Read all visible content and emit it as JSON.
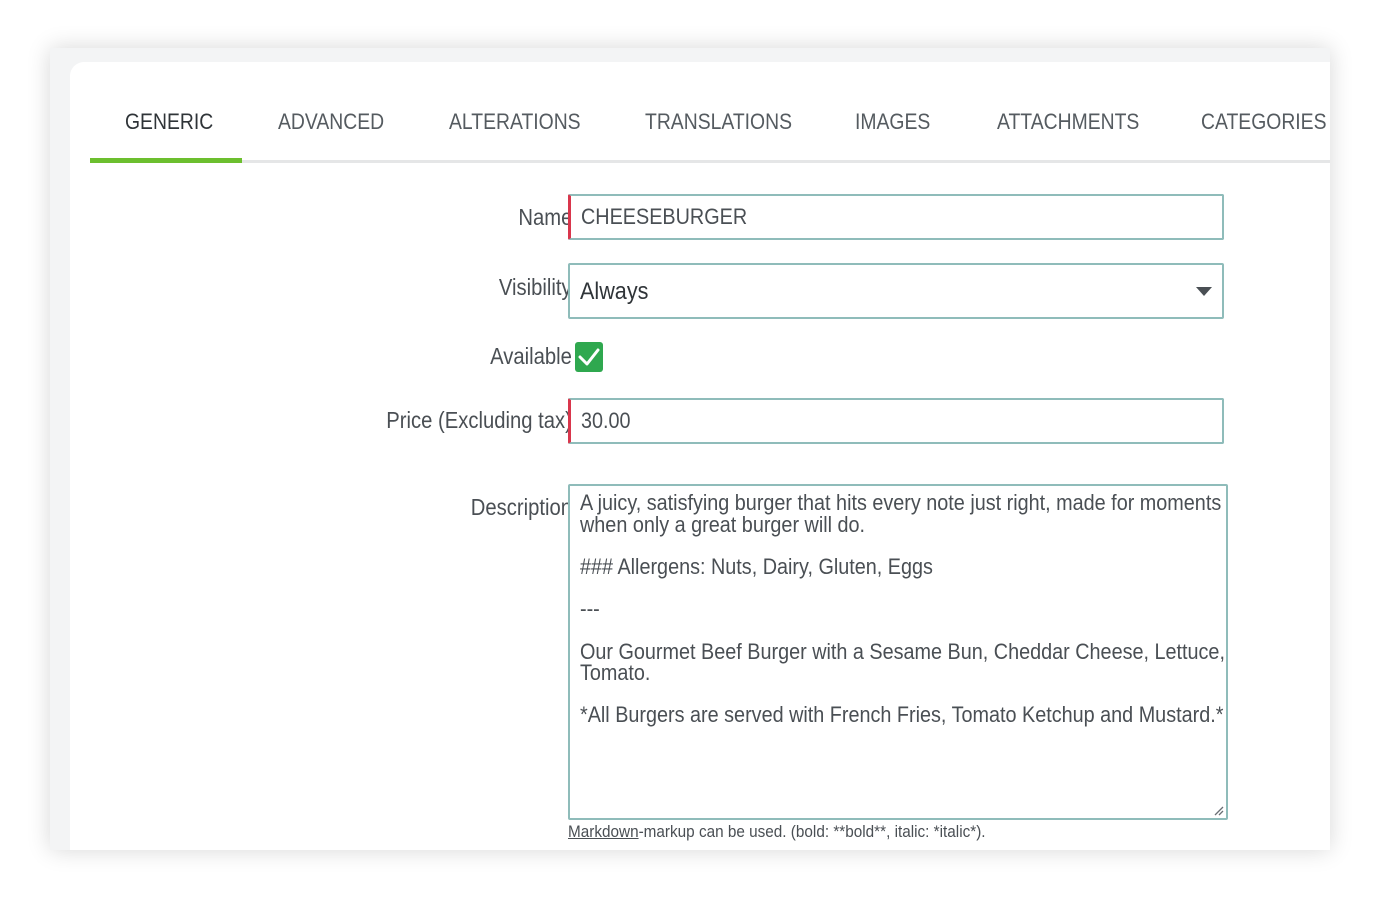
{
  "tabs": [
    {
      "label": "GENERIC",
      "active": true
    },
    {
      "label": "ADVANCED"
    },
    {
      "label": "ALTERATIONS"
    },
    {
      "label": "TRANSLATIONS"
    },
    {
      "label": "IMAGES"
    },
    {
      "label": "ATTACHMENTS"
    },
    {
      "label": "CATEGORIES"
    }
  ],
  "form": {
    "name": {
      "label": "Name",
      "value": "CHEESEBURGER"
    },
    "visibility": {
      "label": "Visibility",
      "value": "Always"
    },
    "available": {
      "label": "Available",
      "checked": true
    },
    "price": {
      "label": "Price (Excluding tax)",
      "value": "30.00"
    },
    "description": {
      "label": "Description",
      "lines": [
        "A juicy, satisfying burger that hits every note just right, made for moments",
        "when only a great burger will do.",
        "### Allergens: Nuts, Dairy, Gluten, Eggs",
        "---",
        "Our Gourmet Beef Burger with a Sesame Bun, Cheddar Cheese, Lettuce,",
        "Tomato.",
        "*All Burgers are served with French Fries, Tomato Ketchup and Mustard.*"
      ]
    },
    "helper": {
      "link": "Markdown",
      "text": "-markup can be used. (bold: **bold**, italic: *italic*)."
    }
  },
  "colors": {
    "accent": "#6cbf2e",
    "checkbox": "#2fa84f",
    "required_marker": "#d9364c",
    "input_border": "#8fbcba"
  },
  "icons": {
    "dropdown": "chevron-down-icon",
    "checkbox": "checkmark-icon",
    "resize": "resize-grip-icon"
  }
}
